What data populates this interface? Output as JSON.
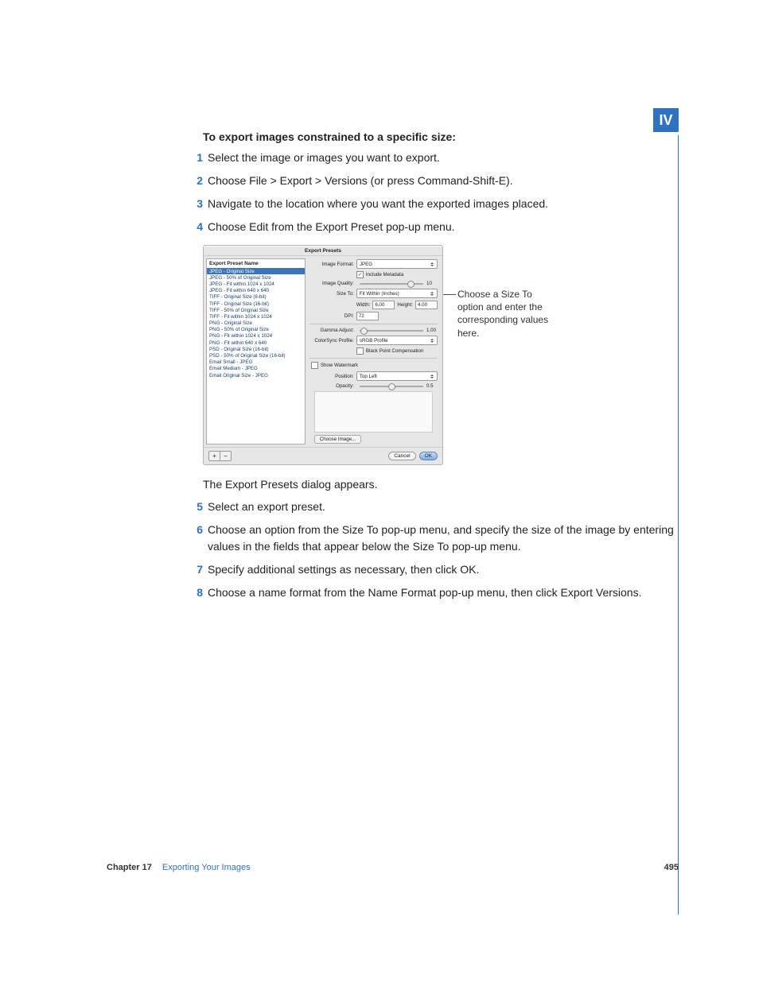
{
  "tab": "IV",
  "heading": "To export images constrained to a specific size:",
  "steps_a": [
    {
      "n": "1",
      "t": "Select the image or images you want to export."
    },
    {
      "n": "2",
      "t": "Choose File > Export > Versions (or press Command-Shift-E)."
    },
    {
      "n": "3",
      "t": "Navigate to the location where you want the exported images placed."
    },
    {
      "n": "4",
      "t": "Choose Edit from the Export Preset pop-up menu."
    }
  ],
  "caption_a": "The Export Presets dialog appears.",
  "steps_b": [
    {
      "n": "5",
      "t": "Select an export preset."
    },
    {
      "n": "6",
      "t": "Choose an option from the Size To pop-up menu, and specify the size of the image by entering values in the fields that appear below the Size To pop-up menu."
    },
    {
      "n": "7",
      "t": "Specify additional settings as necessary, then click OK."
    },
    {
      "n": "8",
      "t": "Choose a name format from the Name Format pop-up menu, then click Export Versions."
    }
  ],
  "annotation": "Choose a Size To option and enter the corresponding values here.",
  "dialog": {
    "title": "Export Presets",
    "sideHeader": "Export Preset Name",
    "presets": [
      "JPEG - Original Size",
      "JPEG - 50% of Original Size",
      "JPEG - Fit within 1024 x 1024",
      "JPEG - Fit within 640 x 640",
      "TIFF - Original Size (8-bit)",
      "TIFF - Original Size (16-bit)",
      "TIFF - 50% of Original Size",
      "TIFF - Fit within 1024 x 1024",
      "PNG - Original Size",
      "PNG - 50% of Original Size",
      "PNG - Fit within 1024 x 1024",
      "PNG - Fit within 640 x 640",
      "PSD - Original Size (16-bit)",
      "PSD - 50% of Original Size (16-bit)",
      "Email Small - JPEG",
      "Email Medium - JPEG",
      "Email Original Size - JPEG"
    ],
    "labels": {
      "imageFormat": "Image Format:",
      "includeMeta": "Include Metadata",
      "imageQuality": "Image Quality:",
      "sizeTo": "Size To:",
      "width": "Width:",
      "height": "Height:",
      "dpi": "DPI:",
      "gamma": "Gamma Adjust:",
      "colorsync": "ColorSync Profile:",
      "blackPoint": "Black Point Compensation",
      "showWatermark": "Show Watermark",
      "position": "Position:",
      "opacity": "Opacity:",
      "chooseImage": "Choose Image...",
      "cancel": "Cancel",
      "ok": "OK"
    },
    "values": {
      "imageFormat": "JPEG",
      "quality": "10",
      "sizeTo": "Fit Within (Inches)",
      "width": "6.00",
      "height": "4.00",
      "dpi": "72",
      "gamma": "1.00",
      "colorsync": "sRGB Profile",
      "position": "Top Left",
      "opacity": "0.5"
    }
  },
  "footer": {
    "chapter": "Chapter 17",
    "title": "Exporting Your Images",
    "page": "495"
  }
}
